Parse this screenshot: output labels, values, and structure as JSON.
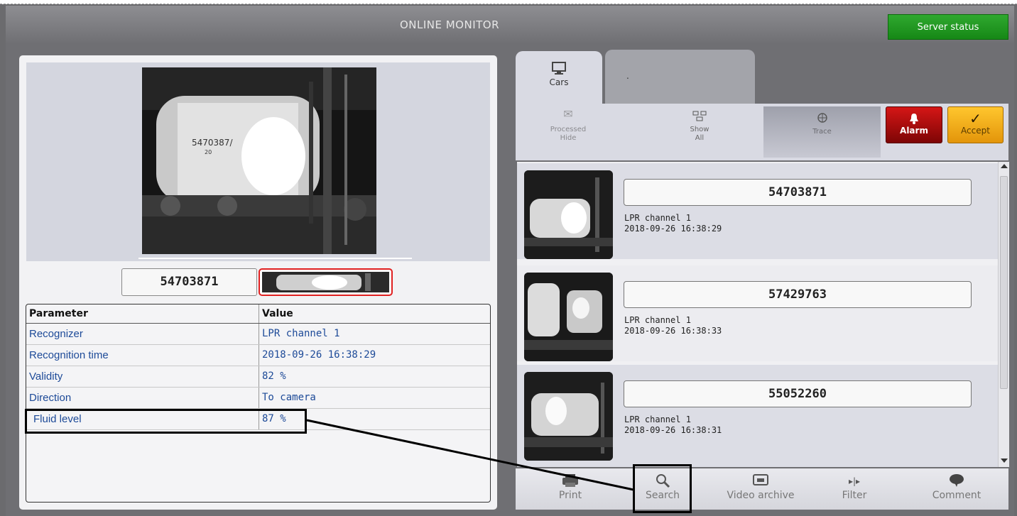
{
  "header": {
    "title": "ONLINE MONITOR",
    "server_status": "Server status"
  },
  "left": {
    "plate": "54703871",
    "camera_text": "5470387/",
    "camera_text_2": "20",
    "table": {
      "headers": [
        "Parameter",
        "Value"
      ],
      "rows": [
        {
          "param": "Recognizer",
          "value": "LPR channel 1"
        },
        {
          "param": "Recognition time",
          "value": "2018-09-26 16:38:29"
        },
        {
          "param": "Validity",
          "value": "82 %"
        },
        {
          "param": "Direction",
          "value": "To camera"
        },
        {
          "param": "Fluid level",
          "value": "87 %"
        }
      ]
    }
  },
  "tabs": [
    {
      "label": "Cars",
      "icon": "monitor-icon"
    },
    {
      "label": "."
    }
  ],
  "toolbar": {
    "processed_line1": "Processed",
    "processed_line2": "Hide",
    "show_line1": "Show",
    "show_line2": "All",
    "trace": "Trace",
    "alarm": "Alarm",
    "accept": "Accept",
    "colors": {
      "alarm": "#b50e0e",
      "accept": "#f2ad1c",
      "server_status": "#1f981f"
    }
  },
  "cars": [
    {
      "plate": "54703871",
      "channel": "LPR channel 1",
      "time": "2018-09-26 16:38:29"
    },
    {
      "plate": "57429763",
      "channel": "LPR channel 1",
      "time": "2018-09-26 16:38:33"
    },
    {
      "plate": "55052260",
      "channel": "LPR channel 1",
      "time": "2018-09-26 16:38:31"
    }
  ],
  "bottom": {
    "print": "Print",
    "search": "Search",
    "video_archive": "Video archive",
    "filter": "Filter",
    "comment": "Comment"
  }
}
